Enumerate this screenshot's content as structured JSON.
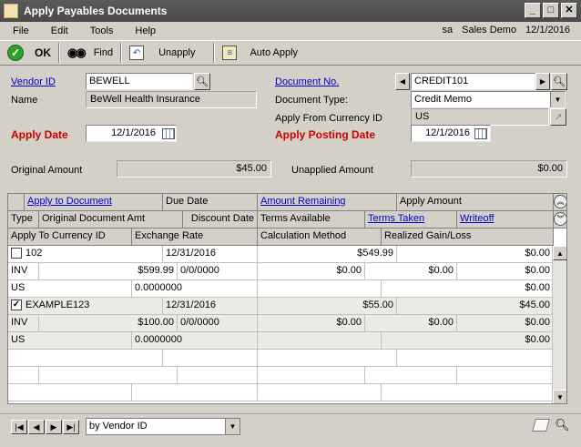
{
  "window": {
    "title": "Apply Payables Documents"
  },
  "menu": {
    "items": [
      "File",
      "Edit",
      "Tools",
      "Help"
    ],
    "user": "sa",
    "company": "Sales Demo",
    "date": "12/1/2016"
  },
  "toolbar": {
    "ok": "OK",
    "find": "Find",
    "unapply": "Unapply",
    "auto_apply": "Auto Apply"
  },
  "form": {
    "vendor_id_label": "Vendor ID",
    "vendor_id": "BEWELL",
    "name_label": "Name",
    "name": "BeWell Health Insurance",
    "apply_date_label": "Apply Date",
    "apply_date": "12/1/2016",
    "document_no_label": "Document No.",
    "document_no": "CREDIT101",
    "document_type_label": "Document Type:",
    "document_type": "Credit Memo",
    "currency_label": "Apply From Currency ID",
    "currency": "US",
    "posting_date_label": "Apply Posting Date",
    "posting_date": "12/1/2016",
    "original_amount_label": "Original Amount",
    "original_amount": "$45.00",
    "unapplied_amount_label": "Unapplied Amount",
    "unapplied_amount": "$0.00"
  },
  "grid": {
    "headers": {
      "apply_to_document": "Apply to Document",
      "due_date": "Due Date",
      "amount_remaining": "Amount Remaining",
      "apply_amount": "Apply Amount",
      "type": "Type",
      "original_document_amt": "Original Document Amt",
      "discount_date": "Discount Date",
      "terms_available": "Terms Available",
      "terms_taken": "Terms Taken",
      "writeoff": "Writeoff",
      "apply_to_currency": "Apply To Currency ID",
      "exchange_rate": "Exchange Rate",
      "calculation_method": "Calculation Method",
      "realized_gain_loss": "Realized Gain/Loss"
    },
    "records": [
      {
        "checked": false,
        "document": "102",
        "due_date": "12/31/2016",
        "amount_remaining": "$549.99",
        "apply_amount": "$0.00",
        "type": "INV",
        "original_amt": "$599.99",
        "discount_date": "0/0/0000",
        "terms_available": "$0.00",
        "terms_taken": "$0.00",
        "writeoff": "$0.00",
        "currency": "US",
        "exchange_rate": "0.0000000",
        "realized": "$0.00"
      },
      {
        "checked": true,
        "document": "EXAMPLE123",
        "due_date": "12/31/2016",
        "amount_remaining": "$55.00",
        "apply_amount": "$45.00",
        "type": "INV",
        "original_amt": "$100.00",
        "discount_date": "0/0/0000",
        "terms_available": "$0.00",
        "terms_taken": "$0.00",
        "writeoff": "$0.00",
        "currency": "US",
        "exchange_rate": "0.0000000",
        "realized": "$0.00"
      }
    ]
  },
  "status": {
    "sort_by": "by Vendor ID"
  },
  "icons": {
    "ok": "check-circle-icon",
    "find": "binoculars-icon",
    "unapply": "unapply-icon",
    "auto_apply": "auto-apply-icon",
    "lookup": "magnifier-icon",
    "calendar": "calendar-icon",
    "note": "note-icon"
  }
}
